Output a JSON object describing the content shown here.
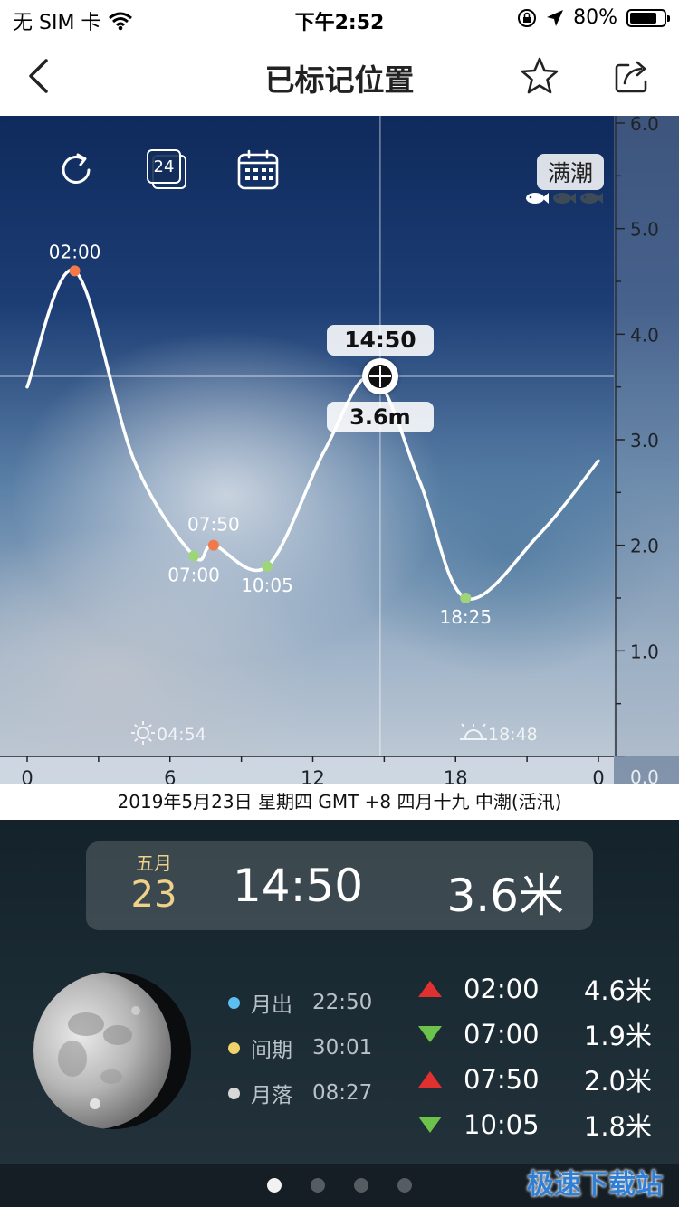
{
  "status_bar": {
    "carrier": "无 SIM 卡",
    "time": "下午2:52",
    "battery_percent": "80%",
    "battery_level": 0.8
  },
  "nav": {
    "title": "已标记位置",
    "icons": {
      "back": "chevron-left-icon",
      "favorite": "star-icon",
      "share": "share-icon"
    }
  },
  "chart_toolbar": {
    "refresh_icon": "refresh-icon",
    "hours_badge": "24",
    "calendar_icon": "calendar-icon",
    "tide_state": "满潮",
    "fish_activity": {
      "active": 1,
      "total": 3
    }
  },
  "chart_data": {
    "type": "line",
    "x_range": [
      0,
      24
    ],
    "ylim": [
      0,
      6
    ],
    "y_ticks": [
      "6.0",
      "5.0",
      "4.0",
      "3.0",
      "2.0",
      "1.0",
      "0.0"
    ],
    "x_ticks": [
      "0",
      "6",
      "12",
      "18",
      "0"
    ],
    "points": [
      {
        "x": 0,
        "y": 3.5
      },
      {
        "x": 2.0,
        "y": 4.6
      },
      {
        "x": 4.5,
        "y": 2.8
      },
      {
        "x": 7.0,
        "y": 1.9
      },
      {
        "x": 7.83,
        "y": 2.0
      },
      {
        "x": 10.08,
        "y": 1.8
      },
      {
        "x": 12.5,
        "y": 2.9
      },
      {
        "x": 14.5,
        "y": 3.6
      },
      {
        "x": 16.5,
        "y": 2.6
      },
      {
        "x": 18.42,
        "y": 1.5
      },
      {
        "x": 21.5,
        "y": 2.1
      },
      {
        "x": 24,
        "y": 2.8
      }
    ],
    "events": [
      {
        "time": "02:00",
        "x": 2.0,
        "y": 4.6,
        "type": "high"
      },
      {
        "time": "07:00",
        "x": 7.0,
        "y": 1.9,
        "type": "low"
      },
      {
        "time": "07:50",
        "x": 7.83,
        "y": 2.0,
        "type": "high"
      },
      {
        "time": "10:05",
        "x": 10.08,
        "y": 1.8,
        "type": "low"
      },
      {
        "time": "18:25",
        "x": 18.42,
        "y": 1.5,
        "type": "low"
      }
    ],
    "cursor": {
      "x": 14.83,
      "y": 3.6,
      "time_label": "14:50",
      "height_label": "3.6m"
    },
    "sunrise": "04:54",
    "sunset": "18:48"
  },
  "date_strip": "2019年5月23日 星期四 GMT +8 四月十九 中潮(活汛)",
  "summary": {
    "month": "五月",
    "day": "23",
    "time": "14:50",
    "height": "3.6米"
  },
  "moon": {
    "rows": [
      {
        "label": "月出",
        "value": "22:50",
        "color": "#5bc0f0"
      },
      {
        "label": "间期",
        "value": "30:01",
        "color": "#f2d36b"
      },
      {
        "label": "月落",
        "value": "08:27",
        "color": "#d7d7d7"
      }
    ]
  },
  "tides": [
    {
      "type": "high",
      "time": "02:00",
      "height": "4.6米"
    },
    {
      "type": "low",
      "time": "07:00",
      "height": "1.9米"
    },
    {
      "type": "high",
      "time": "07:50",
      "height": "2.0米"
    },
    {
      "type": "low",
      "time": "10:05",
      "height": "1.8米"
    }
  ],
  "pager": {
    "count": 4,
    "active": 0
  },
  "watermark": "极速下载站"
}
